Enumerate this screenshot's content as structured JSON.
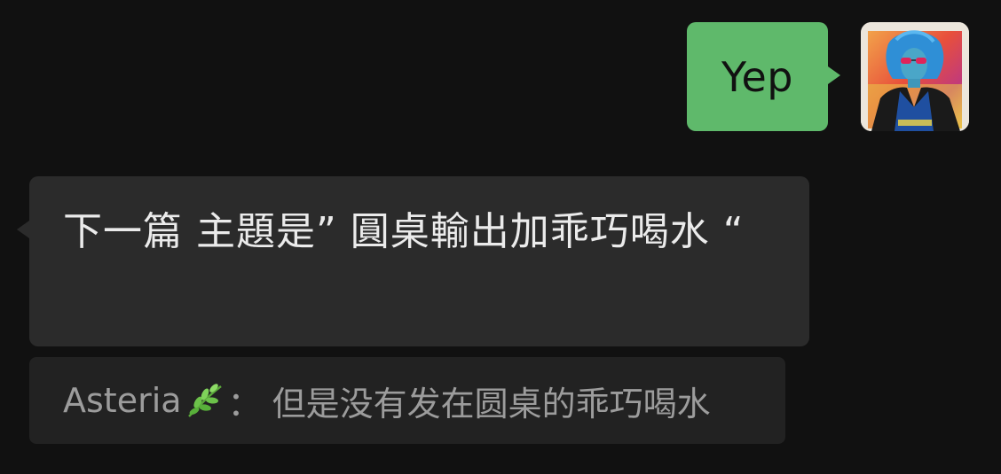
{
  "outgoing": {
    "text": "Yep",
    "bubble_color": "#5fb96b",
    "avatar": "user-avatar-portrait"
  },
  "incoming": {
    "text": "下一篇 主題是” 圓桌輸出加乖巧喝水 “",
    "bubble_color": "#2b2b2b"
  },
  "quote": {
    "sender": "Asteria",
    "sender_icon": "herb-icon",
    "separator": "：",
    "text": "但是没有发在圆桌的乖巧喝水"
  },
  "colors": {
    "background": "#111111",
    "quote_background": "#222222",
    "quote_text": "#9c9c9c"
  }
}
